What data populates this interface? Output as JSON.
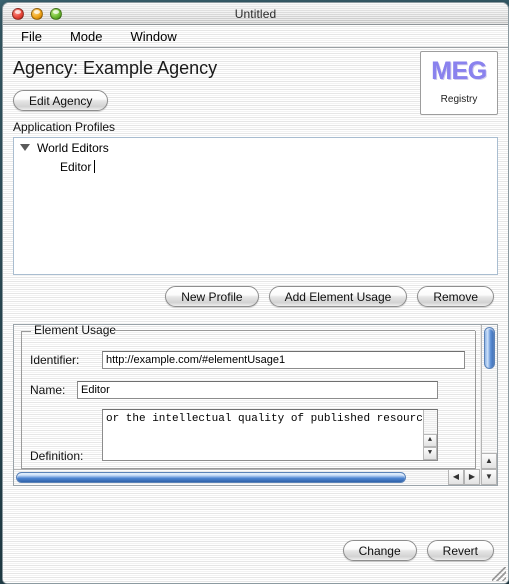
{
  "window": {
    "title": "Untitled",
    "controls": [
      {
        "name": "close",
        "glyph": ""
      },
      {
        "name": "minimize",
        "glyph": ""
      },
      {
        "name": "zoom",
        "glyph": ""
      }
    ]
  },
  "menubar": {
    "items": [
      {
        "label": "File"
      },
      {
        "label": "Mode"
      },
      {
        "label": "Window"
      }
    ]
  },
  "header": {
    "page_title": "Agency: Example Agency",
    "edit_agency_label": "Edit Agency",
    "logo": {
      "mark": "MEG",
      "subtitle": "Registry"
    }
  },
  "profiles": {
    "group_label": "Application Profiles",
    "tree": [
      {
        "label": "World Editors",
        "expanded": true,
        "level": 0,
        "disclosure": "triangle-down-icon"
      },
      {
        "label": "Editor",
        "level": 1,
        "has_caret": true
      }
    ]
  },
  "mid_buttons": {
    "new_profile": "New Profile",
    "add_element_usage": "Add Element Usage",
    "remove": "Remove"
  },
  "element_usage": {
    "legend": "Element Usage",
    "identifier_label": "Identifier:",
    "identifier_value": "http://example.com/#elementUsage1",
    "name_label": "Name:",
    "name_value": "Editor",
    "definition_label": "Definition:",
    "definition_value": "or the intellectual quality of published resource."
  },
  "scrollbars": {
    "v_up_glyph": "▲",
    "v_down_glyph": "▼",
    "h_left_glyph": "◀",
    "h_right_glyph": "▶"
  },
  "bottom_buttons": {
    "change": "Change",
    "revert": "Revert"
  },
  "colors": {
    "aqua_blue": "#4f86d2",
    "logo_purple": "#8a82ee",
    "titlebar_gray": "#d8d8d8",
    "desktop": "#2b4d58"
  }
}
